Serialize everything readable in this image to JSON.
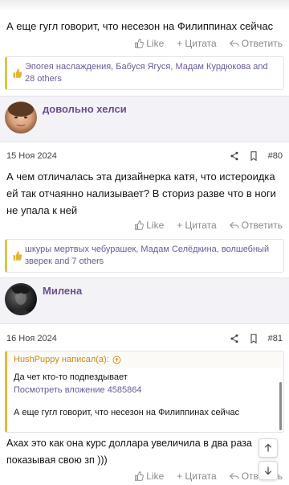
{
  "post1": {
    "text": "А еще гугл говорит, что несезон на Филиппинах сейчас",
    "actions": {
      "like": "Like",
      "quote": "Цитата",
      "reply": "Ответить"
    },
    "likes_text": "Эпогея наслаждения, Бабуся Ягуся, Мадам Курдюкова and 28 others"
  },
  "post80": {
    "username": "довольно хелси",
    "date": "15 Ноя 2024",
    "number": "#80",
    "text": "А чем отличалась эта дизайнерка катя, что истероидка ей так отчаянно нализывает? В сториз разве что в ноги не упала к ней",
    "actions": {
      "like": "Like",
      "quote": "Цитата",
      "reply": "Ответить"
    },
    "likes_text": "шкуры мертвых чебурашек, Мадам Селёдкина, волшебный зверек and 7 others"
  },
  "post81": {
    "username": "Милена",
    "date": "16 Ноя 2024",
    "number": "#81",
    "quote": {
      "author": "HushPuppy написал(а):",
      "line1": "Да чет кто-то подпездывает",
      "link": "Посмотреть вложение 4585864",
      "line2": "А еще гугл говорит, что несезон на Филиппинах сейчас"
    },
    "text": "Ахах это как она курс доллара увеличила в два раза показывая свою зп )))",
    "actions": {
      "like": "Like",
      "quote": "Цитата",
      "reply": "Ответить"
    }
  },
  "colors": {
    "accent": "#6b4f8c",
    "link": "#6b5b95",
    "muted": "#8a8a8a",
    "quote_border": "#e8b83a",
    "likes_border": "#d6c64f"
  }
}
